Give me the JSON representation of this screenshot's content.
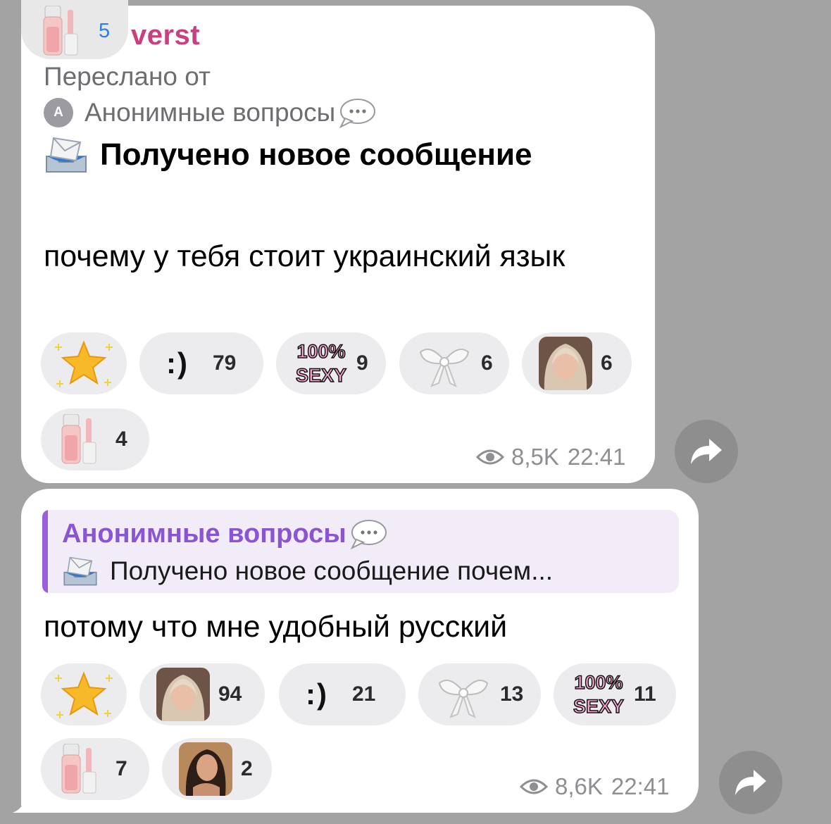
{
  "message1": {
    "author": {
      "name_visible": "verst",
      "badge_count": "5",
      "avatar_icon": "lip-gloss-icon"
    },
    "forwarded_label": "Переслано от",
    "forwarded_from": {
      "avatar_letter": "A",
      "name": "Анонимные вопросы"
    },
    "title": "Получено новое сообщение",
    "body": "почему у тебя стоит украинский язык",
    "reactions": [
      {
        "icon": "sparkle-star-icon",
        "count": ""
      },
      {
        "icon": "smiley-text-icon",
        "label": ":)",
        "count": "79"
      },
      {
        "icon": "100-sexy-sticker-icon",
        "label_line1": "100%",
        "label_line2": "SEXY",
        "count": "9"
      },
      {
        "icon": "bow-icon",
        "count": "6"
      },
      {
        "icon": "avatar-photo-blonde-icon",
        "count": "6"
      },
      {
        "icon": "lip-gloss-icon",
        "count": "4"
      }
    ],
    "views": "8,5K",
    "time": "22:41"
  },
  "message2": {
    "reply": {
      "name": "Анонимные вопросы",
      "text": "Получено новое сообщение почем..."
    },
    "body": "потому что мне удобный русский",
    "reactions": [
      {
        "icon": "sparkle-star-icon",
        "count": ""
      },
      {
        "icon": "avatar-photo-blonde-icon",
        "count": "94"
      },
      {
        "icon": "smiley-text-icon",
        "label": ":)",
        "count": "21"
      },
      {
        "icon": "bow-icon",
        "count": "13"
      },
      {
        "icon": "100-sexy-sticker-icon",
        "label_line1": "100%",
        "label_line2": "SEXY",
        "count": "11"
      },
      {
        "icon": "lip-gloss-icon",
        "count": "7"
      },
      {
        "icon": "avatar-photo-brunette-icon",
        "count": "2"
      }
    ],
    "views": "8,6K",
    "time": "22:41"
  },
  "colors": {
    "background": "#a3a3a3",
    "author_name": "#c8417e",
    "reply_accent": "#9a60dc",
    "reply_bg": "#f2ecf9",
    "reaction_bg": "#ececee",
    "meta_text": "#8e8e93",
    "badge_count": "#2c7fe6"
  }
}
